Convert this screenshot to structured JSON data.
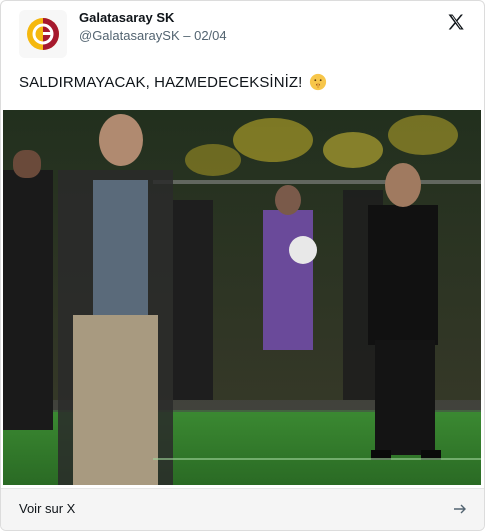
{
  "post": {
    "author_name": "Galatasaray SK",
    "author_handle_date": "@GalatasaraySK – 02/04",
    "text": "SALDIRMAYACAK, HAZMEDECEKSİNİZ!",
    "emoji": "shushing-face-icon"
  },
  "media": {
    "description_icon": "photo"
  },
  "footer": {
    "link_label": "Voir sur X"
  },
  "colors": {
    "brand_red": "#a6192e",
    "brand_yellow": "#f5b80f",
    "pitch_green": "#2f7a2a"
  }
}
